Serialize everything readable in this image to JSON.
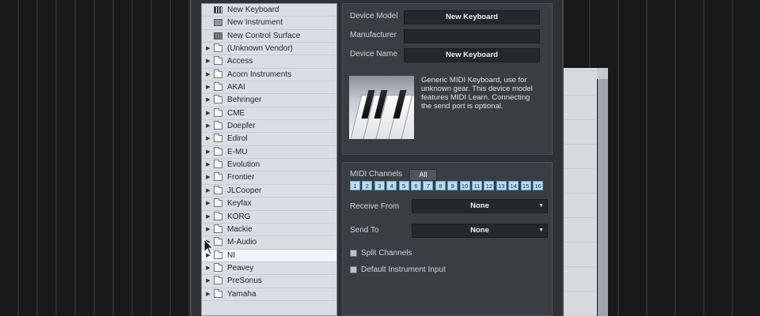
{
  "device_list": {
    "items": [
      {
        "label": "New Keyboard",
        "icon": "keyboard-icon",
        "expandable": false
      },
      {
        "label": "New Instrument",
        "icon": "instrument-icon",
        "expandable": false
      },
      {
        "label": "New Control Surface",
        "icon": "control-surface-icon",
        "expandable": false
      },
      {
        "label": "(Unknown Vendor)",
        "icon": "folder-icon",
        "expandable": true
      },
      {
        "label": "Access",
        "icon": "folder-icon",
        "expandable": true
      },
      {
        "label": "Acorn Instruments",
        "icon": "folder-icon",
        "expandable": true
      },
      {
        "label": "AKAI",
        "icon": "folder-icon",
        "expandable": true
      },
      {
        "label": "Behringer",
        "icon": "folder-icon",
        "expandable": true
      },
      {
        "label": "CME",
        "icon": "folder-icon",
        "expandable": true
      },
      {
        "label": "Doepfer",
        "icon": "folder-icon",
        "expandable": true
      },
      {
        "label": "Edirol",
        "icon": "folder-icon",
        "expandable": true
      },
      {
        "label": "E-MU",
        "icon": "folder-icon",
        "expandable": true
      },
      {
        "label": "Evolution",
        "icon": "folder-icon",
        "expandable": true
      },
      {
        "label": "Frontier",
        "icon": "folder-icon",
        "expandable": true
      },
      {
        "label": "JLCooper",
        "icon": "folder-icon",
        "expandable": true
      },
      {
        "label": "Keyfax",
        "icon": "folder-icon",
        "expandable": true
      },
      {
        "label": "KORG",
        "icon": "folder-icon",
        "expandable": true
      },
      {
        "label": "Mackie",
        "icon": "folder-icon",
        "expandable": true
      },
      {
        "label": "M-Audio",
        "icon": "folder-icon",
        "expandable": true
      },
      {
        "label": "NI",
        "icon": "folder-icon",
        "expandable": true,
        "selected": true
      },
      {
        "label": "Peavey",
        "icon": "folder-icon",
        "expandable": true
      },
      {
        "label": "PreSonus",
        "icon": "folder-icon",
        "expandable": true
      },
      {
        "label": "Yamaha",
        "icon": "folder-icon",
        "expandable": true
      }
    ]
  },
  "device": {
    "model_label": "Device Model",
    "model_value": "New Keyboard",
    "manufacturer_label": "Manufacturer",
    "manufacturer_value": "",
    "name_label": "Device Name",
    "name_value": "New Keyboard",
    "description": "Generic MIDI Keyboard, use for unknown gear. This device model features MIDI Learn. Connecting the send port is optional."
  },
  "midi": {
    "channels_label": "MIDI Channels",
    "all_label": "All",
    "channels": [
      "1",
      "2",
      "3",
      "4",
      "5",
      "6",
      "7",
      "8",
      "9",
      "10",
      "11",
      "12",
      "13",
      "14",
      "15",
      "16"
    ],
    "receive_label": "Receive From",
    "receive_value": "None",
    "send_label": "Send To",
    "send_value": "None",
    "split_label": "Split Channels",
    "default_instr_label": "Default Instrument Input"
  },
  "colors": {
    "channel_active": "#bcdcf1",
    "list_bg": "#d9dee3",
    "panel_bg": "#3a3e43"
  }
}
